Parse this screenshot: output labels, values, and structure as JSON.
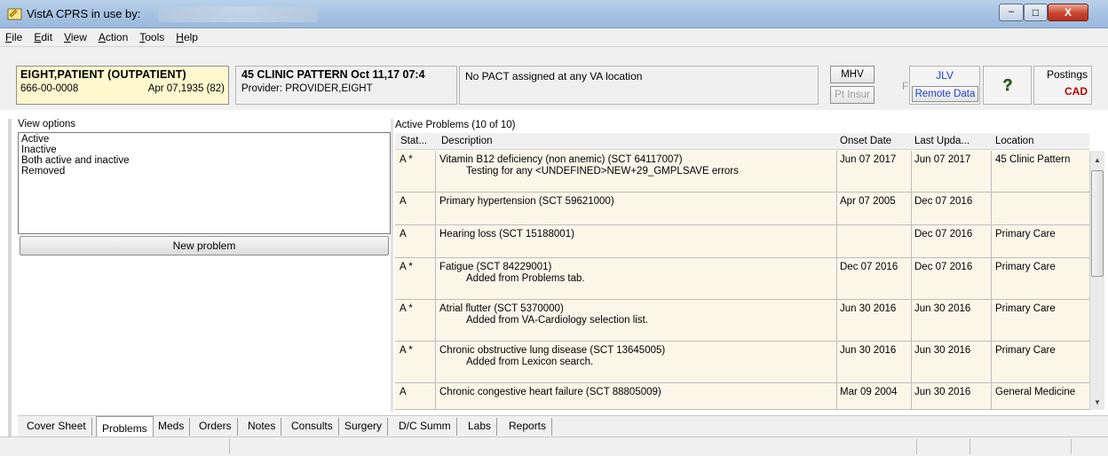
{
  "window": {
    "title": "VistA CPRS in use by:",
    "controls": {
      "minimize": "–",
      "maximize": "□",
      "close": "X"
    }
  },
  "menu": {
    "items": [
      {
        "label": "File",
        "accel": "F",
        "rest": "ile"
      },
      {
        "label": "Edit",
        "accel": "E",
        "rest": "dit"
      },
      {
        "label": "View",
        "accel": "V",
        "rest": "iew"
      },
      {
        "label": "Action",
        "accel": "A",
        "rest": "ction"
      },
      {
        "label": "Tools",
        "accel": "T",
        "rest": "ools"
      },
      {
        "label": "Help",
        "accel": "H",
        "rest": "elp"
      }
    ]
  },
  "patient": {
    "name": "EIGHT,PATIENT (OUTPATIENT)",
    "ssn": "666-00-0008",
    "dob": "Apr 07,1935 (82)"
  },
  "visit": {
    "title": "45 CLINIC PATTERN Oct 11,17 07:4",
    "provider": "Provider:  PROVIDER,EIGHT"
  },
  "pact": {
    "text": "No PACT assigned at any VA location"
  },
  "header_buttons": {
    "mhv": "MHV",
    "pt_insur": "Pt Insur",
    "flag": "Flag",
    "jlv": "JLV",
    "remote_data": "Remote Data",
    "help_icon": "?",
    "postings": "Postings",
    "cad": "CAD"
  },
  "view_options": {
    "label": "View options",
    "items": [
      "Active",
      "Inactive",
      "Both active and inactive",
      "Removed"
    ]
  },
  "new_problem_label": "New problem",
  "problems": {
    "label": "Active Problems  (10 of 10)",
    "columns": [
      "Stat...",
      "Description",
      "Onset Date",
      "Last Upda...",
      "Location"
    ],
    "rows": [
      {
        "stat": "A *",
        "desc": "Vitamin B12 deficiency (non anemic) (SCT 64117007)",
        "note": "Testing for any <UNDEFINED>NEW+29_GMPLSAVE errors",
        "onset": "Jun 07 2017",
        "updated": "Jun 07 2017",
        "location": "45 Clinic Pattern"
      },
      {
        "stat": "A",
        "desc": "Primary hypertension (SCT 59621000)",
        "note": "",
        "onset": "Apr 07 2005",
        "updated": "Dec 07 2016",
        "location": ""
      },
      {
        "stat": "A",
        "desc": "Hearing loss (SCT 15188001)",
        "note": "",
        "onset": "",
        "updated": "Dec 07 2016",
        "location": "Primary Care"
      },
      {
        "stat": "A *",
        "desc": "Fatigue (SCT 84229001)",
        "note": "Added from Problems tab.",
        "onset": "Dec 07 2016",
        "updated": "Dec 07 2016",
        "location": "Primary Care"
      },
      {
        "stat": "A *",
        "desc": "Atrial flutter (SCT 5370000)",
        "note": "Added from VA-Cardiology selection list.",
        "onset": "Jun 30 2016",
        "updated": "Jun 30 2016",
        "location": "Primary Care"
      },
      {
        "stat": "A *",
        "desc": "Chronic obstructive lung disease (SCT 13645005)",
        "note": "Added from Lexicon search.",
        "onset": "Jun 30 2016",
        "updated": "Jun 30 2016",
        "location": "Primary Care"
      },
      {
        "stat": "A",
        "desc": "Chronic congestive heart failure (SCT 88805009)",
        "note": "",
        "onset": "Mar 09 2004",
        "updated": "Jun 30 2016",
        "location": "General Medicine"
      }
    ]
  },
  "tabs": [
    "Cover Sheet",
    "Problems",
    "Meds",
    "Orders",
    "Notes",
    "Consults",
    "Surgery",
    "D/C Summ",
    "Labs",
    "Reports"
  ],
  "active_tab": "Problems"
}
